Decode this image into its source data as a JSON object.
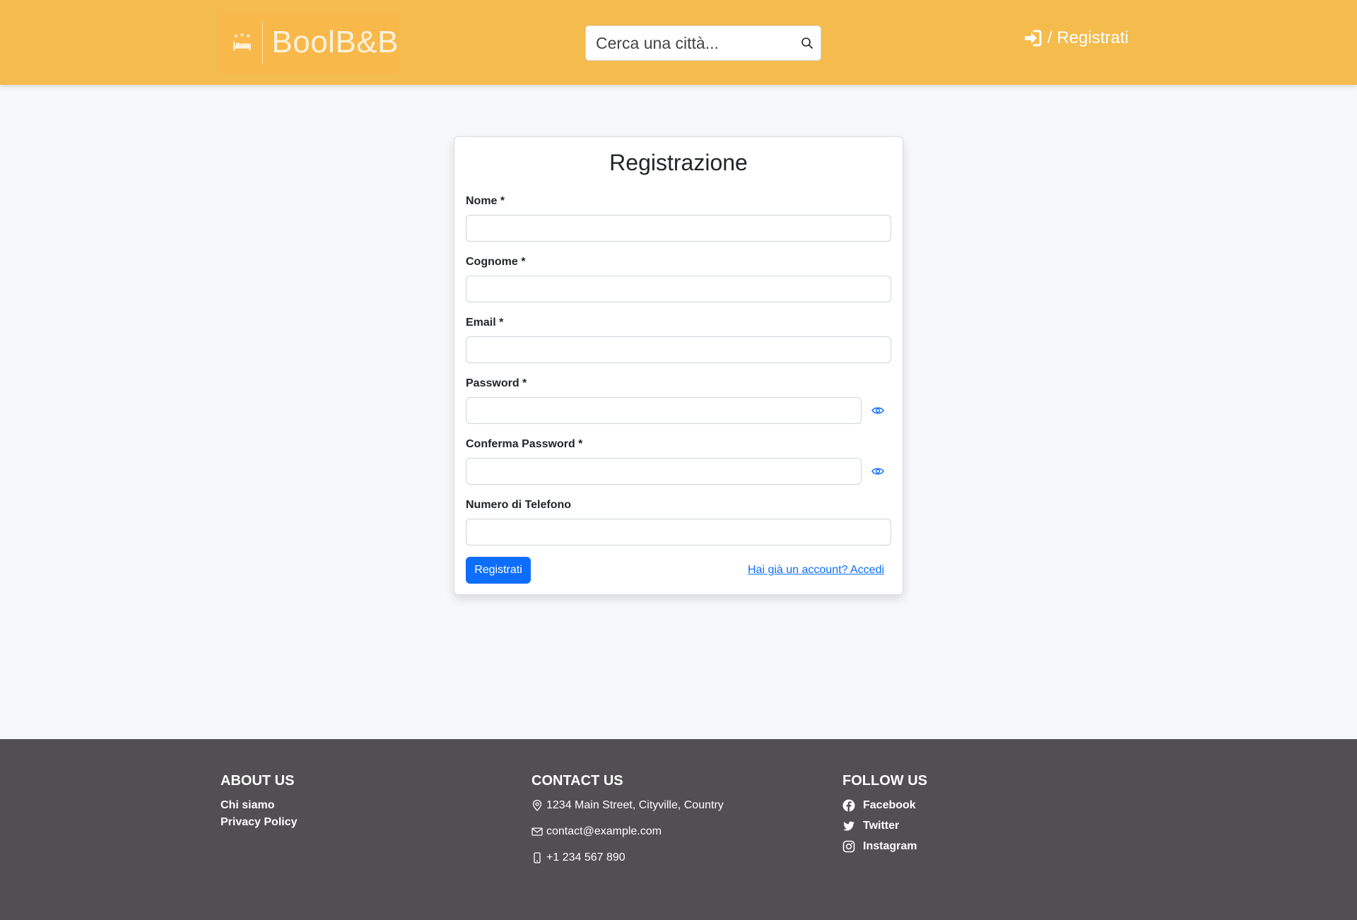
{
  "header": {
    "brand": "BoolB&B",
    "search_placeholder": "Cerca una città...",
    "auth_link": "/ Registrati"
  },
  "form": {
    "title": "Registrazione",
    "fields": [
      {
        "label": "Nome *",
        "value": ""
      },
      {
        "label": "Cognome *",
        "value": ""
      },
      {
        "label": "Email *",
        "value": ""
      },
      {
        "label": "Password *",
        "value": ""
      },
      {
        "label": "Conferma Password *",
        "value": ""
      },
      {
        "label": "Numero di Telefono",
        "value": ""
      }
    ],
    "submit_label": "Registrati",
    "login_link": "Hai già un account? Accedi"
  },
  "footer": {
    "about": {
      "heading": "ABOUT US",
      "links": [
        "Chi siamo",
        "Privacy Policy"
      ]
    },
    "contact": {
      "heading": "CONTACT US",
      "address": "1234 Main Street, Cityville, Country",
      "email": "contact@example.com",
      "phone": "+1 234 567 890"
    },
    "follow": {
      "heading": "FOLLOW US",
      "links": [
        "Facebook",
        "Twitter",
        "Instagram"
      ]
    }
  },
  "colors": {
    "header_bg": "#f4bb4d",
    "primary": "#0d6efd",
    "footer_bg": "#514f51"
  }
}
